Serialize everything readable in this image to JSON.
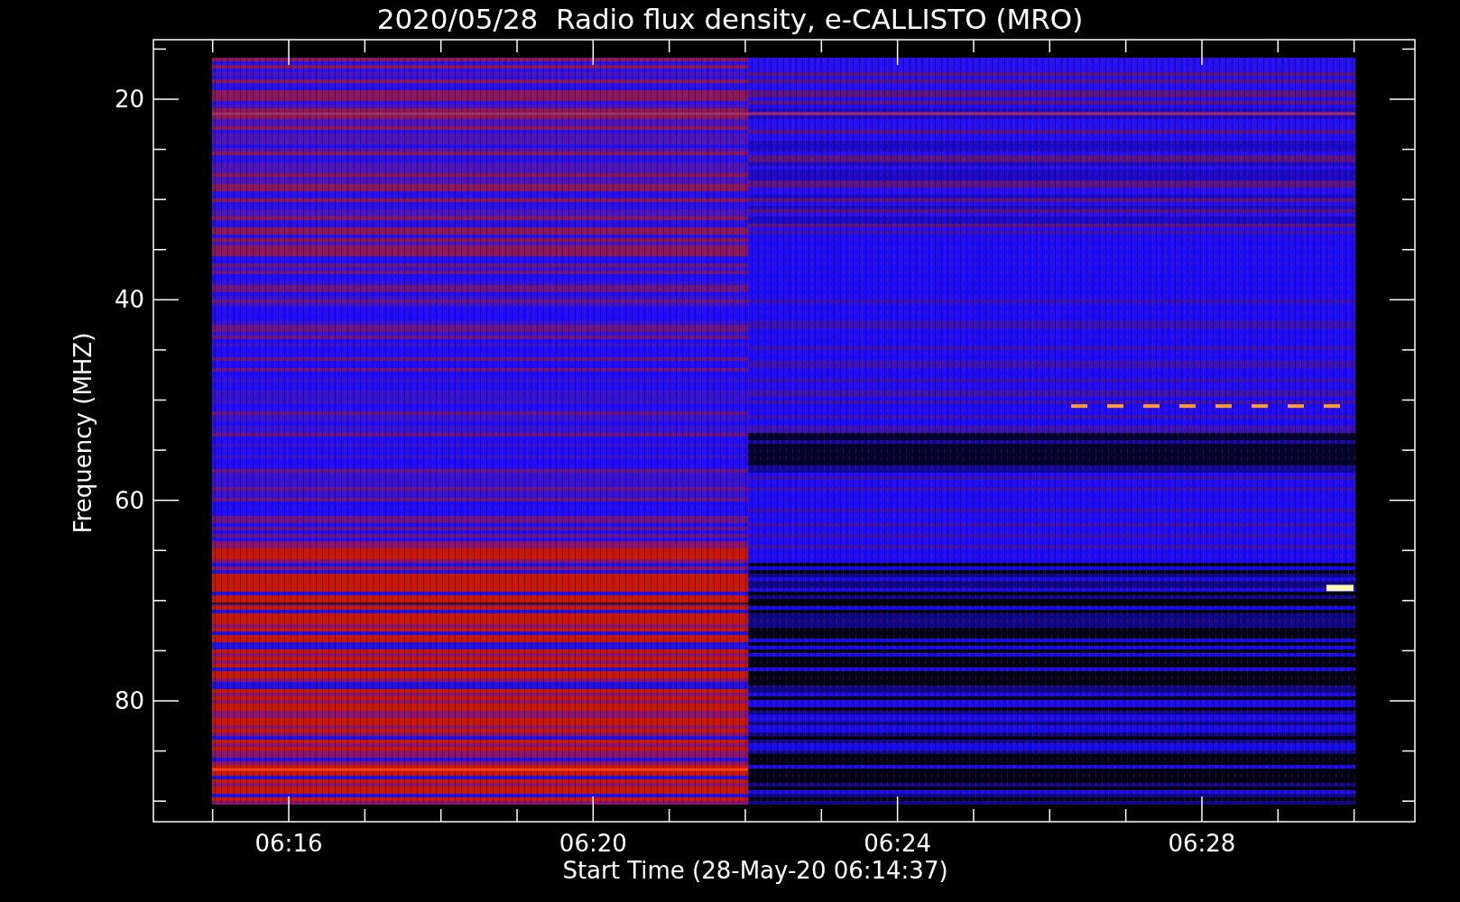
{
  "title": "2020/05/28  Radio flux density, e-CALLISTO (MRO)",
  "y_axis": {
    "label": "Frequency (MHZ)",
    "ticks": [
      "20",
      "40",
      "60",
      "80"
    ]
  },
  "x_axis": {
    "label": "Start Time (28-May-20 06:14:37)",
    "ticks": [
      "06:16",
      "06:20",
      "06:24",
      "06:28"
    ]
  }
}
